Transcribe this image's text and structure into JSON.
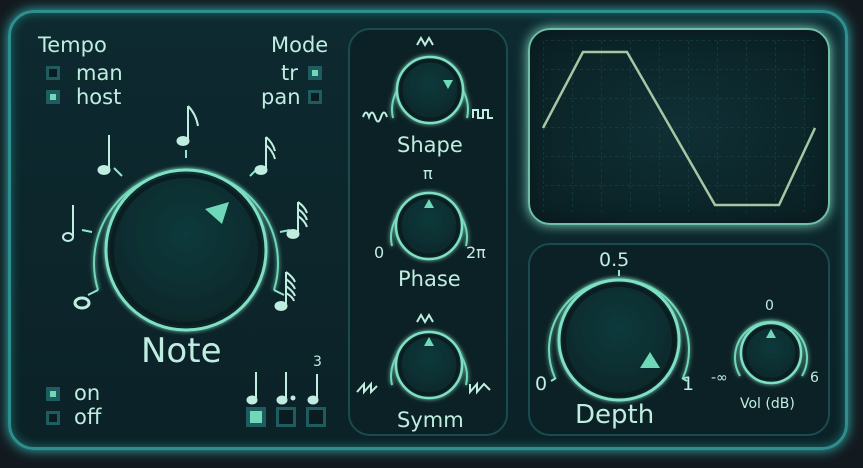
{
  "tempo": {
    "title": "Tempo",
    "options": [
      {
        "label": "man",
        "checked": false
      },
      {
        "label": "host",
        "checked": true
      }
    ]
  },
  "mode": {
    "title": "Mode",
    "options": [
      {
        "label": "tr",
        "checked": true
      },
      {
        "label": "pan",
        "checked": false
      }
    ]
  },
  "note": {
    "label": "Note",
    "note_icons": [
      "half-note-icon",
      "quarter-note-icon",
      "eighth-note-icon",
      "sixteenth-note-icon",
      "thirty-second-note-icon",
      "sixty-fourth-note-icon",
      "whole-note-icon"
    ]
  },
  "power": {
    "options": [
      {
        "label": "on",
        "checked": true
      },
      {
        "label": "off",
        "checked": false
      }
    ]
  },
  "note_type": {
    "triplet_label": "3",
    "options": [
      {
        "icon": "straight-note-icon",
        "checked": true
      },
      {
        "icon": "dotted-note-icon",
        "checked": false
      },
      {
        "icon": "triplet-note-icon",
        "checked": false
      }
    ]
  },
  "shape": {
    "label": "Shape",
    "icons": [
      "triangle-wave-icon",
      "sine-wave-icon",
      "square-wave-icon"
    ]
  },
  "phase": {
    "label": "Phase",
    "min_label": "0",
    "mid_label": "π",
    "max_label": "2π"
  },
  "symm": {
    "label": "Symm",
    "icons": [
      "saw-down-icon",
      "triangle-wave-icon",
      "saw-up-icon"
    ]
  },
  "depth": {
    "label": "Depth",
    "min_label": "0",
    "mid_label": "0.5",
    "max_label": "1"
  },
  "volume": {
    "label": "Vol (dB)",
    "min_label": "-∞",
    "mid_label": "0",
    "max_label": "6"
  },
  "colors": {
    "accent": "#6fd8b8",
    "panel": "#0c2125",
    "border": "#2f8e8e",
    "text": "#bfeee1"
  }
}
